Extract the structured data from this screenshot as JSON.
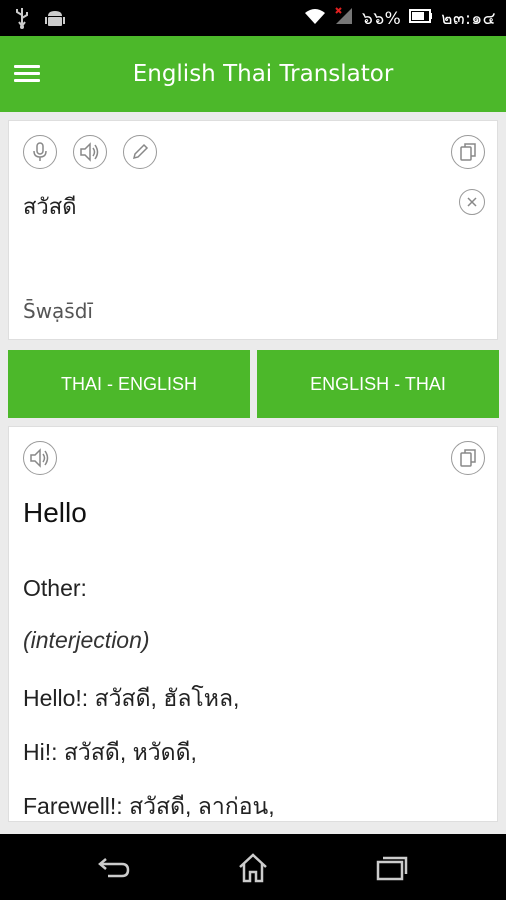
{
  "status_bar": {
    "battery_text": "๖๖%",
    "time": "๒๓:๑๔",
    "icons": [
      "usb-icon",
      "android-icon",
      "wifi-icon",
      "signal-icon",
      "battery-icon"
    ]
  },
  "app_bar": {
    "title": "English Thai Translator",
    "menu_icon": "hamburger-menu-icon"
  },
  "input_card": {
    "icons": [
      "microphone-icon",
      "speaker-icon",
      "pencil-icon",
      "copy-icon",
      "clear-icon"
    ],
    "text": "สวัสดี",
    "transliteration": "S̄wạs̄dī"
  },
  "direction_buttons": {
    "thai_english": "THAI - ENGLISH",
    "english_thai": "ENGLISH - THAI"
  },
  "output_card": {
    "icons": [
      "speaker-icon",
      "copy-icon"
    ],
    "translation": "Hello",
    "other_label": "Other:",
    "part_of_speech": "(interjection)",
    "entries": [
      "Hello!: สวัสดี, ฮัลโหล,",
      "Hi!: สวัสดี, หวัดดี,",
      "Farewell!: สวัสดี, ลาก่อน,"
    ]
  },
  "nav_bar": {
    "icons": [
      "back-icon",
      "home-icon",
      "recent-apps-icon"
    ]
  },
  "colors": {
    "accent_green": "#4cb82a",
    "background": "#ebebeb"
  }
}
